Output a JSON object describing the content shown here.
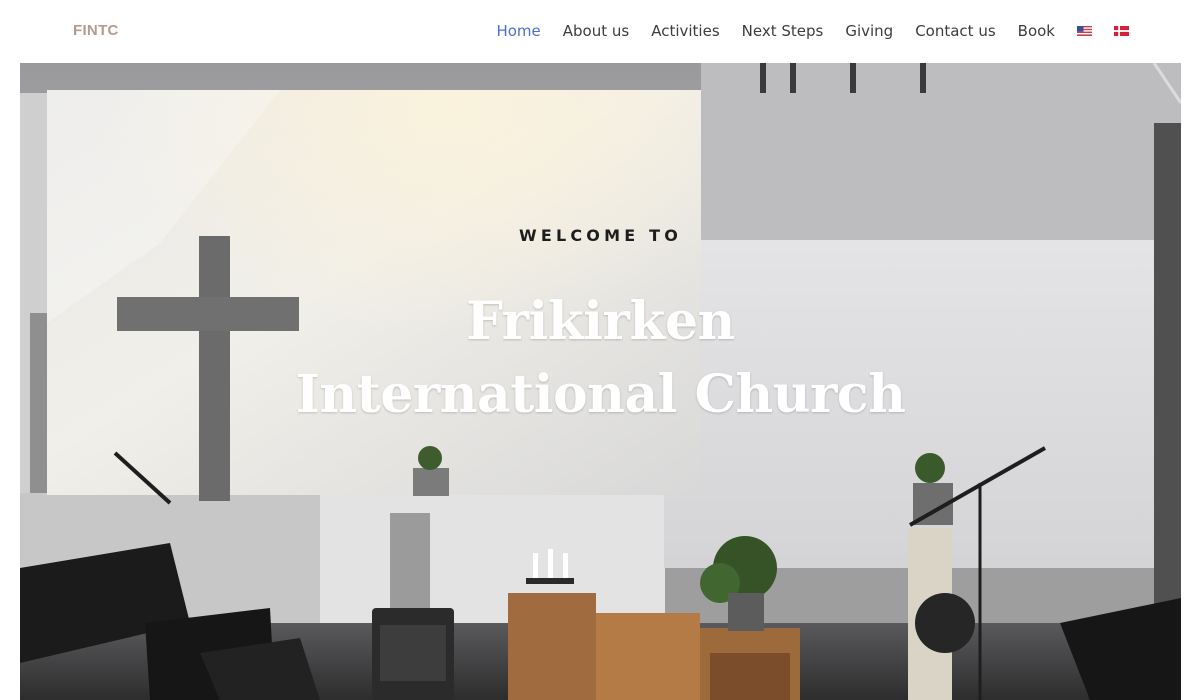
{
  "site": {
    "logo": "FINTC"
  },
  "nav": {
    "items": [
      {
        "label": "Home",
        "active": true
      },
      {
        "label": "About us",
        "active": false
      },
      {
        "label": "Activities",
        "active": false
      },
      {
        "label": "Next Steps",
        "active": false
      },
      {
        "label": "Giving",
        "active": false
      },
      {
        "label": "Contact us",
        "active": false
      },
      {
        "label": "Book",
        "active": false
      }
    ],
    "languages": [
      {
        "icon": "us-flag-icon"
      },
      {
        "icon": "danish-flag-icon"
      }
    ]
  },
  "hero": {
    "kicker": "WELCOME TO",
    "title_line1": "Frikirken",
    "title_line2": "International Church"
  },
  "colors": {
    "logo": "#b39a8d",
    "nav_text": "#3d3d3d",
    "nav_active": "#4a72c8",
    "title": "#ffffff",
    "kicker": "#1d1d1d"
  }
}
